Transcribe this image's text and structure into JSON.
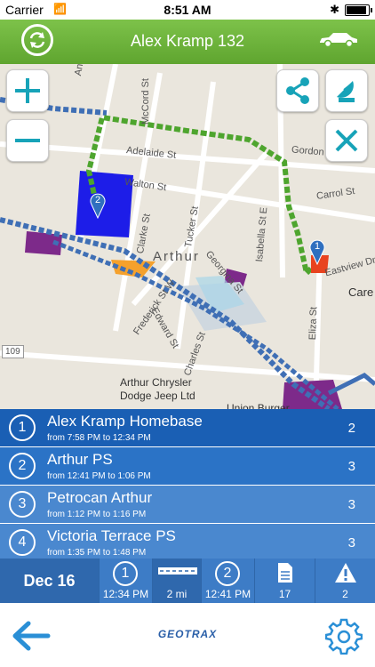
{
  "status_bar": {
    "carrier": "Carrier",
    "time": "8:51 AM"
  },
  "header": {
    "title": "Alex Kramp 132",
    "sync_icon": "sync-icon",
    "vehicle_icon": "car-icon",
    "bg": "#6ab43c"
  },
  "map": {
    "labels": [
      "Andrew St",
      "McCord St",
      "Adelaide St",
      "Walton St",
      "Gordon",
      "Carrol St",
      "Clarke St",
      "Tucker St",
      "Isabella St E",
      "Georgina St",
      "Eastview Dr",
      "Care",
      "Arthur",
      "Frederick St W",
      "Edward St",
      "Charles St",
      "Eliza St",
      "Arthur Chrysler",
      "Dodge Jeep Ltd",
      "Union Burger",
      "109"
    ],
    "markers": [
      {
        "label": "2"
      },
      {
        "label": "1"
      }
    ],
    "controls": {
      "zoom_in": "+",
      "zoom_out": "−",
      "share_icon": "share-icon",
      "satellite_icon": "satellite-icon",
      "close_icon": "close-icon"
    }
  },
  "stops": [
    {
      "num": "1",
      "name": "Alex Kramp Homebase",
      "time": "from 7:58 PM to 12:34 PM",
      "count": "2",
      "color": "#1a5fb4"
    },
    {
      "num": "2",
      "name": "Arthur PS",
      "time": "from 12:41 PM to 1:06 PM",
      "count": "3",
      "color": "#2b73c6"
    },
    {
      "num": "3",
      "name": "Petrocan Arthur",
      "time": "from 1:12 PM to 1:16 PM",
      "count": "3",
      "color": "#4a88cf"
    },
    {
      "num": "4",
      "name": "Victoria Terrace PS",
      "time": "from 1:35 PM to 1:48 PM",
      "count": "3",
      "color": "#4a88cf"
    }
  ],
  "bottom_bar": {
    "date": "Dec 16",
    "stop_start": {
      "num": "1",
      "time": "12:34 PM"
    },
    "distance": "2 mi",
    "stop_end": {
      "num": "2",
      "time": "12:41 PM"
    },
    "documents": "17",
    "alerts": "2"
  },
  "footer": {
    "back_icon": "back-arrow-icon",
    "logo": "GEOTRAX",
    "settings_icon": "gear-icon"
  }
}
